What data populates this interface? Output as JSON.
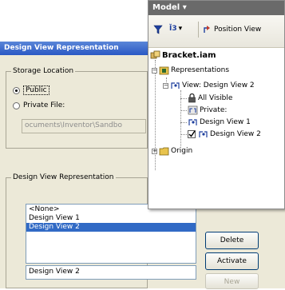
{
  "dialog": {
    "title": "Design View Representation",
    "storage_group": {
      "legend": "Storage Location",
      "public_label": "Public",
      "private_label": "Private File:",
      "private_path": "ocuments\\Inventor\\Sandbo"
    },
    "list_group": {
      "legend": "Design View Representation",
      "items": [
        {
          "label": "<None>"
        },
        {
          "label": "Design View 1"
        },
        {
          "label": "Design View 2"
        }
      ],
      "name_value": "Design View 2"
    },
    "buttons": {
      "delete": "Delete",
      "activate": "Activate",
      "new": "New"
    }
  },
  "model_browser": {
    "title": "Model",
    "title_arrow": "▾",
    "toolbar": {
      "filter_icon": "funnel-icon",
      "view_icon_label": "Ĭ3",
      "dropdown_arrow": "▾",
      "position_view_label": "Position View"
    },
    "tree": {
      "root": "Bracket.iam",
      "representations": "Representations",
      "view_node": "View: Design View 2",
      "all_visible": "All Visible",
      "private": "Private:",
      "design_view_1": "Design View 1",
      "design_view_2": "Design View 2",
      "origin": "Origin"
    }
  }
}
